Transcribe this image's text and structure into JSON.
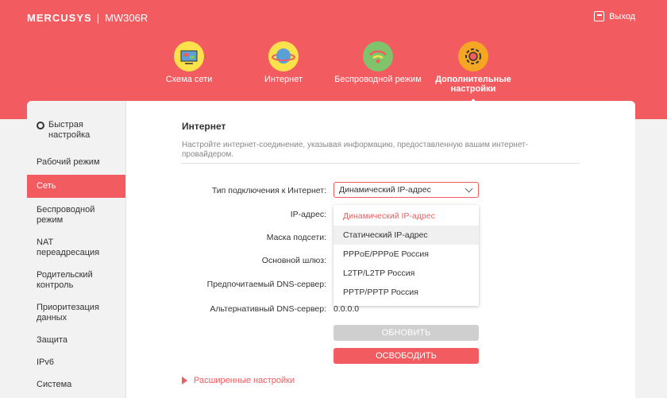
{
  "brand": {
    "name": "MERCUSYS",
    "separator": "|",
    "model": "MW306R"
  },
  "logout_label": "Выход",
  "nav": [
    {
      "label": "Схема сети",
      "icon": "network-map-icon"
    },
    {
      "label": "Интернет",
      "icon": "planet-icon"
    },
    {
      "label": "Беспроводной режим",
      "icon": "wifi-icon"
    },
    {
      "label": "Дополнительные настройки",
      "icon": "settings-gear-icon"
    }
  ],
  "sidebar": {
    "items": [
      {
        "label": "Быстрая настройка",
        "icon": "gear-icon"
      },
      {
        "label": "Рабочий режим"
      },
      {
        "label": "Сеть"
      },
      {
        "label": "Беспроводной режим"
      },
      {
        "label": "NAT переадресация"
      },
      {
        "label": "Родительский контроль"
      },
      {
        "label": "Приоритезация данных"
      },
      {
        "label": "Защита"
      },
      {
        "label": "IPv6"
      },
      {
        "label": "Система"
      }
    ],
    "active_index": 2
  },
  "content": {
    "title": "Интернет",
    "description": "Настройте интернет-соединение, указывая информацию, предоставленную вашим интернет-провайдером.",
    "fields": {
      "connection_type_label": "Тип подключения к Интернет:",
      "ip_label": "IP-адрес:",
      "mask_label": "Маска подсети:",
      "gateway_label": "Основной шлюз:",
      "dns1_label": "Предпочитаемый DNS-сервер:",
      "dns2_label": "Альтернативный DNS-сервер:",
      "dns2_value": "0.0.0.0"
    },
    "select": {
      "value": "Динамический IP-адрес",
      "options": [
        "Динамический IP-адрес",
        "Статический IP-адрес",
        "PPPoE/PPPoE Россия",
        "L2TP/L2TP Россия",
        "PPTP/PPTP Россия"
      ]
    },
    "buttons": {
      "renew": "ОБНОВИТЬ",
      "release": "ОСВОБОДИТЬ"
    },
    "advanced_link": "Расширенные настройки"
  },
  "colors": {
    "accent": "#f25b60",
    "icon_yellow": "#fbe24b",
    "disabled": "#cfcfcf"
  }
}
